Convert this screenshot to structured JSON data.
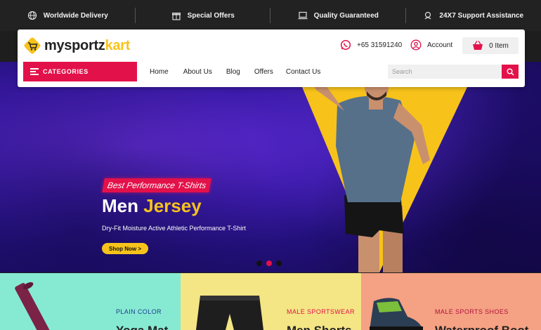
{
  "topbar": {
    "items": [
      {
        "icon": "globe-icon",
        "label": "Worldwide Delivery"
      },
      {
        "icon": "gift-icon",
        "label": "Special Offers"
      },
      {
        "icon": "laptop-icon",
        "label": "Quality Guaranteed"
      },
      {
        "icon": "support-icon",
        "label": "24X7 Support Assistance"
      }
    ]
  },
  "header": {
    "logo": {
      "main": "mysportz",
      "accent": "kart"
    },
    "phone": "+65 31591240",
    "account_label": "Account",
    "cart_label": "0 Item",
    "categories_label": "CATEGORIES",
    "nav": [
      "Home",
      "About Us",
      "Blog",
      "Offers",
      "Contact Us"
    ],
    "search_placeholder": "Search"
  },
  "hero": {
    "tagline": "Best Performance T-Shirts",
    "title_main": "Men",
    "title_accent": "Jersey",
    "subtitle": "Dry-Fit Moisture Active Athletic Performance T-Shirt",
    "button": "Shop Now >"
  },
  "panels": [
    {
      "label": "PLAIN COLOR",
      "name": "Yoga Mat",
      "bg": "#86ead3",
      "label_color": "#1f3b8c"
    },
    {
      "label": "MALE SPORTSWEAR",
      "name": "Men Shorts",
      "bg": "#f4e585",
      "label_color": "#e3114a"
    },
    {
      "label": "MALE SPORTS SHOES",
      "name": "Waterproof Boot",
      "bg": "#f5a183",
      "label_color": "#b0123f"
    }
  ],
  "colors": {
    "accent": "#e3114a",
    "yellow": "#f7c31b",
    "dark": "#222222"
  }
}
